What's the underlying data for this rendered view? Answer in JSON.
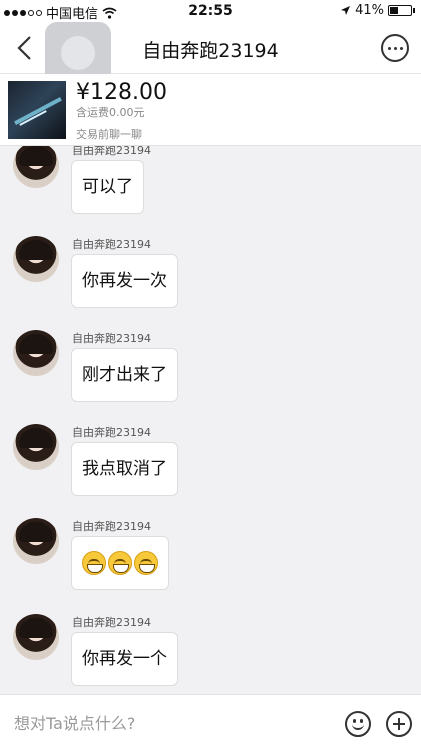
{
  "status_bar": {
    "carrier": "中国电信",
    "time": "22:55",
    "battery": "41%",
    "battery_level": 0.41
  },
  "header": {
    "title": "自由奔跑23194"
  },
  "product": {
    "price": "¥128.00",
    "shipping": "含运费0.00元",
    "hint": "交易前聊一聊"
  },
  "messages": [
    {
      "sender": "自由奔跑23194",
      "text": "可以了"
    },
    {
      "sender": "自由奔跑23194",
      "text": "你再发一次"
    },
    {
      "sender": "自由奔跑23194",
      "text": "刚才出来了"
    },
    {
      "sender": "自由奔跑23194",
      "text": "我点取消了"
    },
    {
      "sender": "自由奔跑23194",
      "emoji": [
        "grin-icon",
        "grin-icon",
        "grin-icon"
      ]
    },
    {
      "sender": "自由奔跑23194",
      "text": "你再发一个"
    }
  ],
  "input": {
    "placeholder": "想对Ta说点什么?"
  }
}
